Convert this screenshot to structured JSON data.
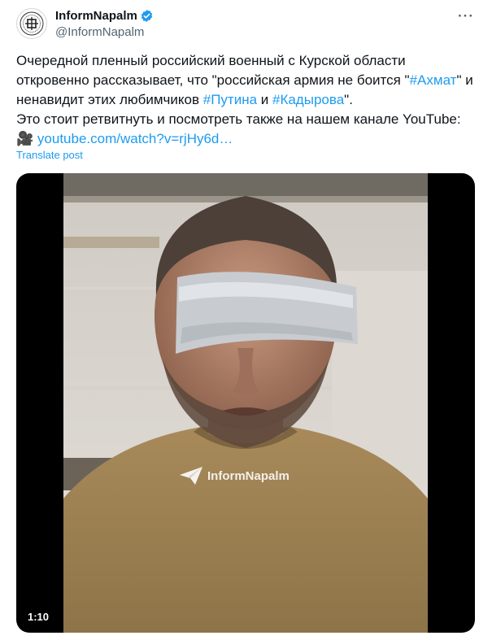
{
  "author": {
    "display_name": "InformNapalm",
    "handle": "@InformNapalm",
    "avatar_icon": "informnapalm-logo",
    "verified_icon": "verified-badge-icon"
  },
  "more_icon": "more-options-icon",
  "tweet": {
    "line1": "Очередной пленный российский военный с Курской области",
    "line2a": "откровенно рассказывает, что \"российская армия не боится \"",
    "tag1": "#Ахмат",
    "line2b": "\" и",
    "line3a": "ненавидит этих любимчиков ",
    "tag2": "#Путина",
    "line3b": " и ",
    "tag3": "#Кадырова",
    "line3c": "\".",
    "line4": "Это стоит ретвитнуть и посмотреть также на нашем канале YouTube:",
    "camera_emoji": "🎥",
    "link": "youtube.com/watch?v=rjHy6d…"
  },
  "translate_label": "Translate post",
  "video": {
    "duration": "1:10",
    "watermark": "InformNapalm"
  },
  "colors": {
    "accent": "#1d9bf0",
    "text": "#0f1419",
    "secondary": "#536471"
  }
}
